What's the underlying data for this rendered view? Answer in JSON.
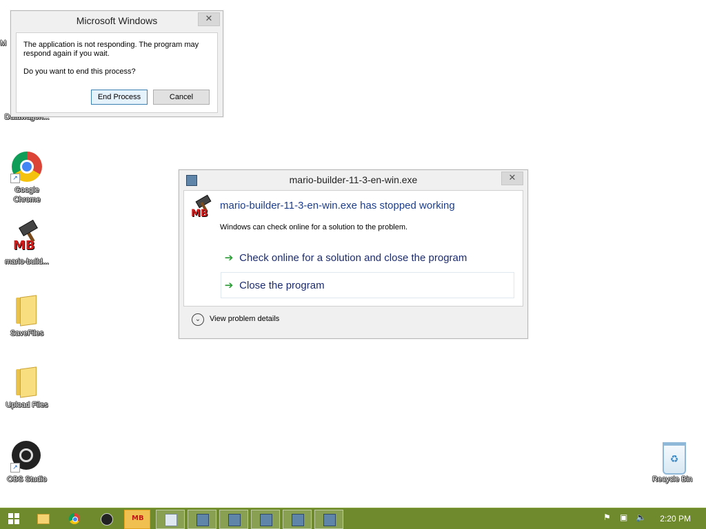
{
  "desktop": {
    "icons": [
      {
        "label": "Datawagon..."
      },
      {
        "label": "Google Chrome"
      },
      {
        "label": "mario-build..."
      },
      {
        "label": "SaveFiles"
      },
      {
        "label": "Upload Files"
      },
      {
        "label": "OBS Studio"
      },
      {
        "label": "Recycle Bin"
      }
    ],
    "partial_label": "M"
  },
  "not_responding_dialog": {
    "title": "Microsoft Windows",
    "message": "The application is not responding. The program may respond again if you wait.",
    "question": "Do you want to end this process?",
    "end_button": "End Process",
    "cancel_button": "Cancel",
    "close_glyph": "✕"
  },
  "crash_dialog": {
    "title": "mario-builder-11-3-en-win.exe",
    "heading": "mario-builder-11-3-en-win.exe has stopped working",
    "subtext": "Windows can check online for a solution to the problem.",
    "option_check": "Check online for a solution and close the program",
    "option_close": "Close the program",
    "details": "View problem details",
    "close_glyph": "✕",
    "arrow_glyph": "➔"
  },
  "taskbar": {
    "clock": "2:20 PM",
    "color": "#6f8a2d"
  }
}
